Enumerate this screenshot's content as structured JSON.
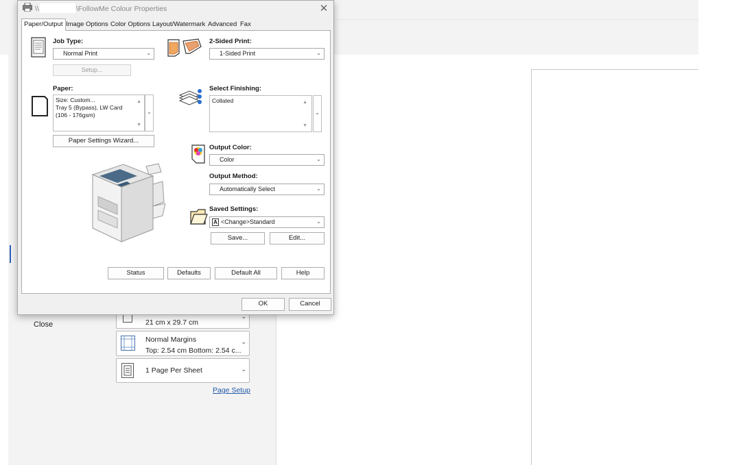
{
  "background": {
    "close_label": "Close",
    "paper_size_card": {
      "line2": "21 cm x 29.7 cm"
    },
    "margins_card": {
      "line1": "Normal Margins",
      "line2": "Top: 2.54 cm Bottom: 2.54 c..."
    },
    "pages_card": {
      "line1": "1 Page Per Sheet"
    },
    "page_setup_link": "Page Setup"
  },
  "dialog": {
    "title_prefix": "\\\\",
    "title_suffix": "\\FollowMe Colour Properties",
    "close_glyph": "✕",
    "tabs": [
      {
        "label": "Paper/Output",
        "active": true
      },
      {
        "label": "Image Options"
      },
      {
        "label": "Color Options"
      },
      {
        "label": "Layout/Watermark"
      },
      {
        "label": "Advanced"
      },
      {
        "label": "Fax"
      }
    ],
    "job_type": {
      "label": "Job Type:",
      "value": "Normal Print",
      "setup_button": "Setup..."
    },
    "two_sided": {
      "label": "2-Sided Print:",
      "value": "1-Sided Print"
    },
    "paper": {
      "label": "Paper:",
      "lines": [
        "Size: Custom...",
        "Tray 5 (Bypass), LW Card",
        "(106 - 176gsm)"
      ],
      "wizard_button": "Paper Settings Wizard..."
    },
    "finishing": {
      "label": "Select Finishing:",
      "value": "Collated"
    },
    "output_color": {
      "label": "Output Color:",
      "value": "Color"
    },
    "output_method": {
      "label": "Output Method:",
      "value": "Automatically Select"
    },
    "saved_settings": {
      "label": "Saved Settings:",
      "value": "<Change>Standard",
      "save_button": "Save...",
      "edit_button": "Edit..."
    },
    "bottom_buttons": {
      "status": "Status",
      "defaults": "Defaults",
      "default_all": "Default All",
      "help": "Help"
    },
    "ok": "OK",
    "cancel": "Cancel"
  }
}
